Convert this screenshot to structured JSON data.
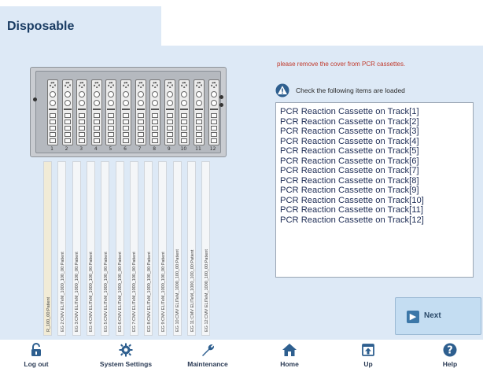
{
  "header": {
    "title": "Disposable"
  },
  "machine": {
    "slot_numbers": [
      "1",
      "2",
      "3",
      "4",
      "5",
      "6",
      "7",
      "8",
      "9",
      "10",
      "11",
      "12"
    ]
  },
  "tracks": [
    "R_100_00:Patient",
    "EG 2:CMV ELITeM_1000_100_00:Patient",
    "EG 3:CMV ELITeM_1000_100_00:Patient",
    "EG 4:CMV ELITeM_1000_100_00:Patient",
    "EG 5:CMV ELITeM_1000_100_00:Patient",
    "EG 6:CMV ELITeM_1000_100_00:Patient",
    "EG 7:CMV ELITeM_1000_100_00:Patient",
    "EG 8:CMV ELITeM_1000_100_00:Patient",
    "EG 9:CMV ELITeM_1000_100_00:Patient",
    "EG 10:CMV ELITeM_1000_100_00:Patient",
    "EG 11:CMV ELITeM_1000_100_00:Patient",
    "EG 12:CMV ELITeM_1000_100_00:Patient"
  ],
  "main": {
    "warning_message": "please remove the cover from PCR cassettes.",
    "check_label": "Check the following items are loaded",
    "check_icon": "warning-triangle-icon",
    "items": [
      "PCR Reaction Cassette on Track[1]",
      "PCR Reaction Cassette on Track[2]",
      "PCR Reaction Cassette on Track[3]",
      "PCR Reaction Cassette on Track[4]",
      "PCR Reaction Cassette on Track[5]",
      "PCR Reaction Cassette on Track[6]",
      "PCR Reaction Cassette on Track[7]",
      "PCR Reaction Cassette on Track[8]",
      "PCR Reaction Cassette on Track[9]",
      "PCR Reaction Cassette on Track[10]",
      "PCR Reaction Cassette on Track[11]",
      "PCR Reaction Cassette on Track[12]"
    ],
    "next_label": "Next",
    "next_icon": "arrow-right-icon"
  },
  "footer": {
    "items": [
      {
        "label": "Log out",
        "icon": "padlock-icon"
      },
      {
        "label": "System Settings",
        "icon": "gear-icon"
      },
      {
        "label": "Maintenance",
        "icon": "wrench-icon"
      },
      {
        "label": "Home",
        "icon": "home-icon"
      },
      {
        "label": "Up",
        "icon": "up-icon"
      },
      {
        "label": "Help",
        "icon": "help-icon"
      }
    ]
  },
  "colors": {
    "panel_bg": "#dde9f6",
    "title_color": "#1a3c63",
    "warning_text": "#c0392b",
    "list_text": "#1e2d56",
    "icon_blue": "#2e5f8f"
  }
}
